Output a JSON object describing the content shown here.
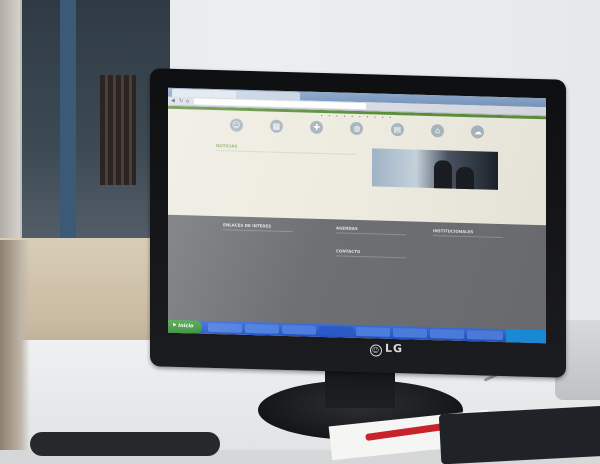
{
  "scene": {
    "colors": {
      "monitor_bezel": "#111214",
      "site_accent": "#5b8f3a",
      "footer_bg": "#6d6f72",
      "taskbar": "#2452c0"
    }
  },
  "monitor": {
    "brand": "LG"
  },
  "browser": {
    "tabs": [
      "",
      ""
    ],
    "address": "",
    "icons": {
      "back": "back-arrow-icon",
      "reload": "reload-icon",
      "home": "home-icon"
    }
  },
  "site": {
    "carousel_dots": "• • • • • • • • • •",
    "nav_icons": [
      {
        "icon": "people-icon",
        "glyph": "☺",
        "label": ""
      },
      {
        "icon": "calendar-icon",
        "glyph": "▦",
        "label": ""
      },
      {
        "icon": "cross-icon",
        "glyph": "✚",
        "label": ""
      },
      {
        "icon": "globe-icon",
        "glyph": "◍",
        "label": ""
      },
      {
        "icon": "document-icon",
        "glyph": "▤",
        "label": ""
      },
      {
        "icon": "building-icon",
        "glyph": "⌂",
        "label": ""
      },
      {
        "icon": "cloud-icon",
        "glyph": "☁",
        "label": ""
      }
    ],
    "news": {
      "title": "NOTICIAS",
      "headline": "",
      "body": ""
    },
    "footer": {
      "col1": {
        "title": "ENLACES DE INTERES",
        "items": [
          "",
          "",
          "",
          "",
          "",
          "",
          "",
          "",
          "",
          ""
        ]
      },
      "col2": {
        "title": "AGENDAS",
        "items": [
          ""
        ],
        "title2": "CONTACTO",
        "items2": [
          "",
          ""
        ]
      },
      "col3": {
        "title": "INSTITUCIONALES",
        "items": [
          "",
          "",
          "",
          "",
          "",
          "",
          ""
        ]
      },
      "copyright": ""
    }
  },
  "taskbar": {
    "start_label": "Inicio",
    "items": [
      "",
      "",
      "",
      "",
      "",
      "",
      "",
      ""
    ],
    "clock": ""
  }
}
